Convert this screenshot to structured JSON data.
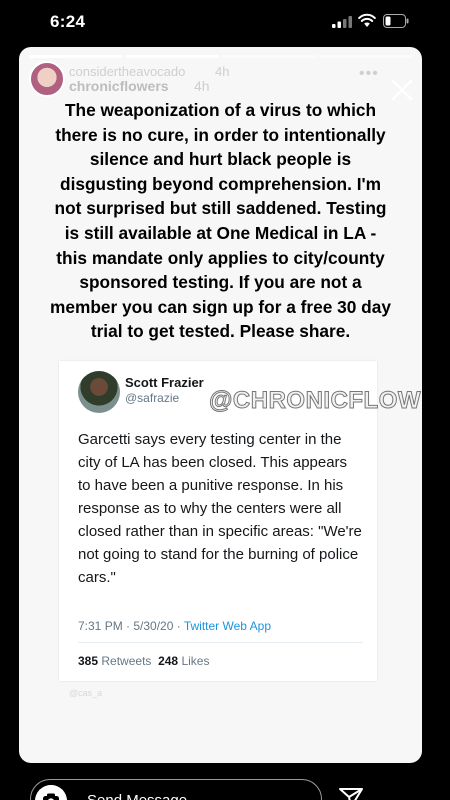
{
  "status_bar": {
    "time": "6:24",
    "icons": [
      "signal-icon",
      "wifi-icon",
      "battery-icon"
    ]
  },
  "story": {
    "progress_segments": 4,
    "ghost_username": "considertheavocado",
    "ghost_time": "4h",
    "username": "chronicflowers",
    "time": "4h",
    "more_icon": "•••",
    "caption": "The weaponization of a virus to which there is no cure, in order to intentionally silence and hurt black people is disgusting beyond comprehension. I'm not surprised but still saddened. Testing is still available at One Medical in LA - this mandate only applies to city/county sponsored testing. If you are not a member you can sign up for a free 30 day trial to get tested. Please share."
  },
  "tweet": {
    "name": "Scott Frazier",
    "handle": "@safrazie",
    "text": "Garcetti says every testing center in the city of LA has been closed. This appears to have been a punitive response. In his response as to why the centers were all closed rather than in specific areas: \"We're not going to stand for the burning of police cars.\"",
    "timestamp": "7:31 PM · 5/30/20 · ",
    "app": "Twitter Web App",
    "retweets_count": "385",
    "retweets_label": "Retweets",
    "likes_count": "248",
    "likes_label": "Likes"
  },
  "watermark": "@CHRONICFLOWERS",
  "faint_mark": "@cas_a",
  "reply": {
    "placeholder": "Send Message"
  },
  "colors": {
    "background": "#000000",
    "card": "#f7f7f7",
    "twitter_blue": "#1b95e0"
  }
}
